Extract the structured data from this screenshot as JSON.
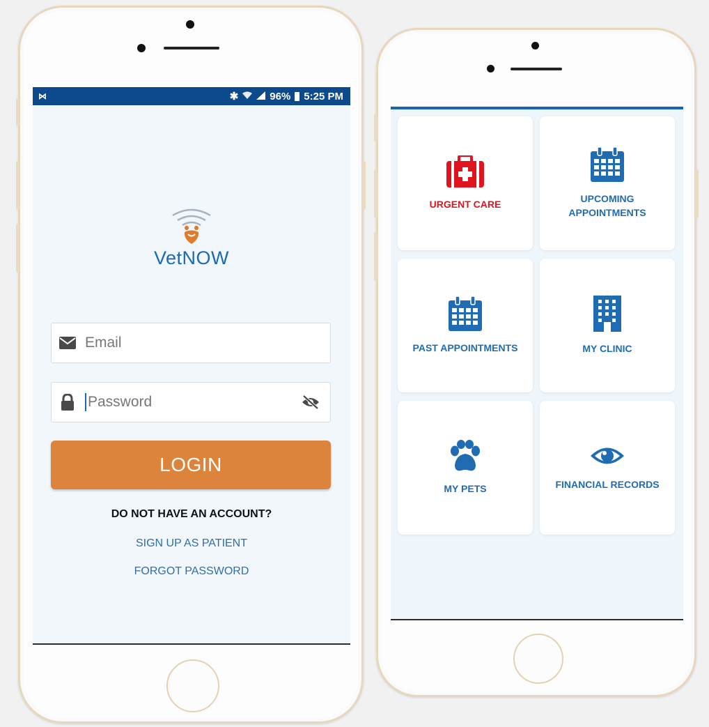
{
  "colors": {
    "status_bar": "#0d4a8b",
    "brand_blue": "#1b6bb3",
    "accent_orange": "#dc843c",
    "urgent_red": "#e0141e",
    "tile_blue": "#1f6cb2",
    "link_blue": "#2f6ea8"
  },
  "login_screen": {
    "status_bar": {
      "left_icon": "cast-icon",
      "battery": "96%",
      "time": "5:25 PM"
    },
    "logo_text": "VetNOW",
    "email": {
      "placeholder": "Email",
      "value": "",
      "icon": "envelope-icon"
    },
    "password": {
      "placeholder": "Password",
      "value": "",
      "icon": "lock-icon",
      "toggle_icon": "eye-off-icon"
    },
    "login_label": "LOGIN",
    "no_account_text": "DO NOT HAVE AN ACCOUNT?",
    "signup_link": "SIGN UP AS PATIENT",
    "forgot_link": "FORGOT PASSWORD"
  },
  "dashboard": {
    "tiles": [
      {
        "label": "URGENT CARE",
        "icon": "first-aid-kit-icon"
      },
      {
        "label": "UPCOMING APPOINTMENTS",
        "icon": "calendar-icon"
      },
      {
        "label": "PAST APPOINTMENTS",
        "icon": "calendar-icon"
      },
      {
        "label": "MY CLINIC",
        "icon": "building-icon"
      },
      {
        "label": "MY PETS",
        "icon": "paw-icon"
      },
      {
        "label": "FINANCIAL RECORDS",
        "icon": "eye-icon"
      }
    ]
  }
}
